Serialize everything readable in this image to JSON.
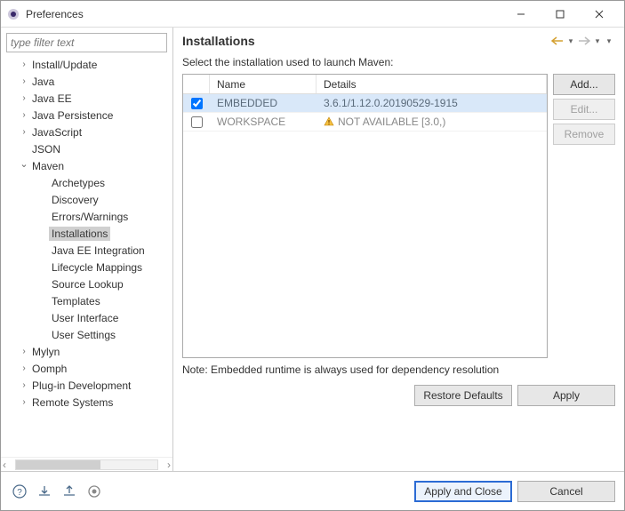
{
  "titlebar": {
    "title": "Preferences"
  },
  "filter": {
    "placeholder": "type filter text"
  },
  "tree": {
    "items": [
      {
        "arrow": ">",
        "label": "Install/Update",
        "level": 1,
        "expanded": false
      },
      {
        "arrow": ">",
        "label": "Java",
        "level": 1,
        "expanded": false
      },
      {
        "arrow": ">",
        "label": "Java EE",
        "level": 1,
        "expanded": false
      },
      {
        "arrow": ">",
        "label": "Java Persistence",
        "level": 1,
        "expanded": false
      },
      {
        "arrow": ">",
        "label": "JavaScript",
        "level": 1,
        "expanded": false
      },
      {
        "arrow": "",
        "label": "JSON",
        "level": 1,
        "expanded": false
      },
      {
        "arrow": "v",
        "label": "Maven",
        "level": 1,
        "expanded": true
      },
      {
        "arrow": "",
        "label": "Archetypes",
        "level": 2
      },
      {
        "arrow": "",
        "label": "Discovery",
        "level": 2
      },
      {
        "arrow": "",
        "label": "Errors/Warnings",
        "level": 2
      },
      {
        "arrow": "",
        "label": "Installations",
        "level": 2,
        "selected": true
      },
      {
        "arrow": "",
        "label": "Java EE Integration",
        "level": 2
      },
      {
        "arrow": "",
        "label": "Lifecycle Mappings",
        "level": 2
      },
      {
        "arrow": "",
        "label": "Source Lookup",
        "level": 2
      },
      {
        "arrow": "",
        "label": "Templates",
        "level": 2
      },
      {
        "arrow": "",
        "label": "User Interface",
        "level": 2
      },
      {
        "arrow": "",
        "label": "User Settings",
        "level": 2
      },
      {
        "arrow": ">",
        "label": "Mylyn",
        "level": 1,
        "expanded": false
      },
      {
        "arrow": ">",
        "label": "Oomph",
        "level": 1,
        "expanded": false
      },
      {
        "arrow": ">",
        "label": "Plug-in Development",
        "level": 1,
        "expanded": false
      },
      {
        "arrow": ">",
        "label": "Remote Systems",
        "level": 1,
        "expanded": false
      }
    ]
  },
  "right": {
    "heading": "Installations",
    "description": "Select the installation used to launch Maven:",
    "columns": {
      "check": "",
      "name": "Name",
      "details": "Details"
    },
    "rows": [
      {
        "checked": true,
        "name": "EMBEDDED",
        "details": "3.6.1/1.12.0.20190529-1915",
        "selected": true,
        "warning": false
      },
      {
        "checked": false,
        "name": "WORKSPACE",
        "details": "NOT AVAILABLE [3.0,)",
        "selected": false,
        "warning": true
      }
    ],
    "buttons": {
      "add": "Add...",
      "edit": "Edit...",
      "remove": "Remove"
    },
    "note": "Note: Embedded runtime is always used for dependency resolution",
    "restore": "Restore Defaults",
    "apply": "Apply"
  },
  "footer": {
    "apply_close": "Apply and Close",
    "cancel": "Cancel"
  }
}
